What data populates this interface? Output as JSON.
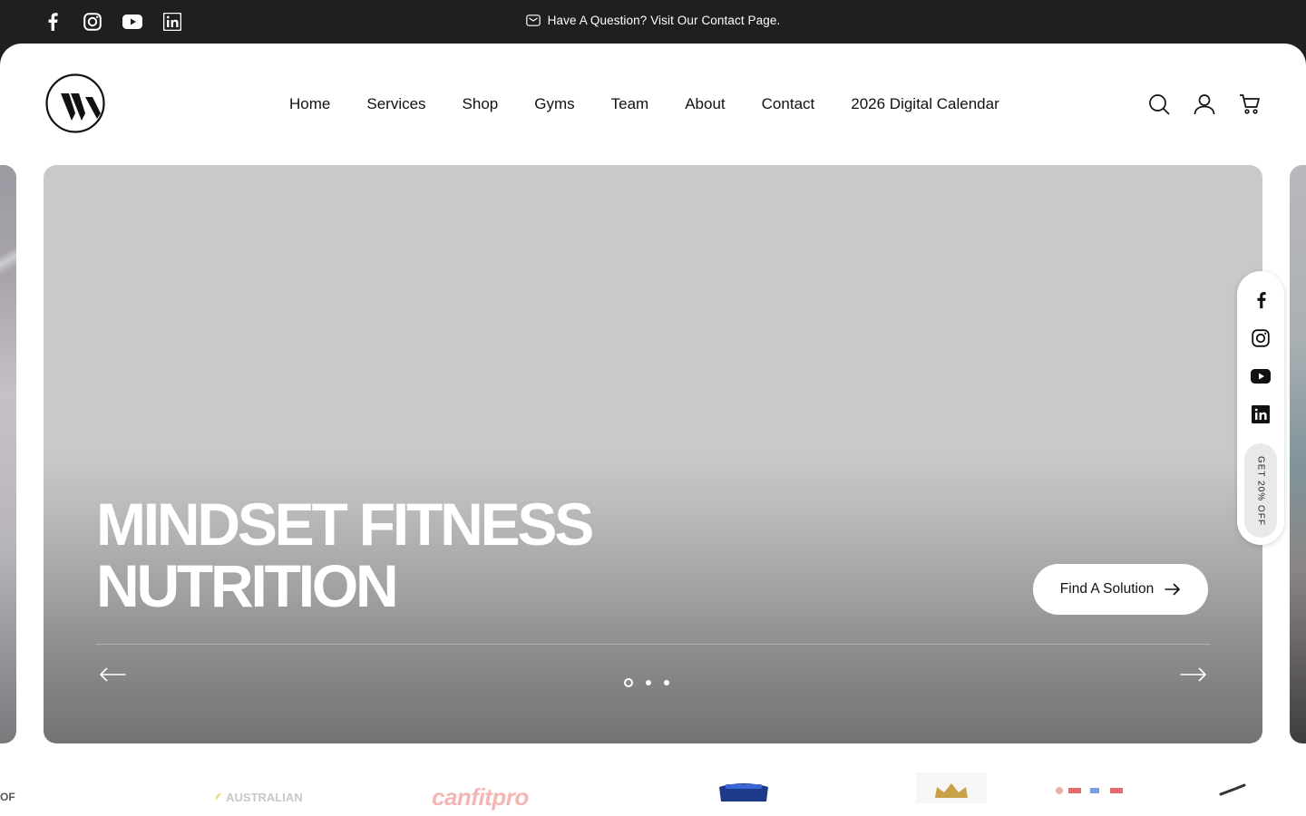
{
  "topbar": {
    "announcement": "Have A Question? Visit Our Contact Page.",
    "socials": [
      "facebook-icon",
      "instagram-icon",
      "youtube-icon",
      "linkedin-icon"
    ]
  },
  "header": {
    "nav": [
      "Home",
      "Services",
      "Shop",
      "Gyms",
      "Team",
      "About",
      "Contact",
      "2026 Digital Calendar"
    ],
    "icons": [
      "search-icon",
      "account-icon",
      "cart-icon"
    ]
  },
  "hero": {
    "title_line1": "MINDSET FITNESS",
    "title_line2": "NUTRITION",
    "cta_label": "Find A Solution",
    "slides_total": 3,
    "active_slide": 1
  },
  "rail": {
    "icons": [
      "facebook-icon",
      "instagram-icon",
      "youtube-icon",
      "linkedin-icon"
    ],
    "promo": "GET 20% OFF"
  },
  "partners": {
    "visible_text": [
      "OF",
      "AUSTRALIAN",
      "canfitpro"
    ]
  },
  "colors": {
    "topbar_bg": "#1f1f1f",
    "page_bg": "#ffffff",
    "hero_bg": "#c9c9c9",
    "text": "#111111"
  }
}
